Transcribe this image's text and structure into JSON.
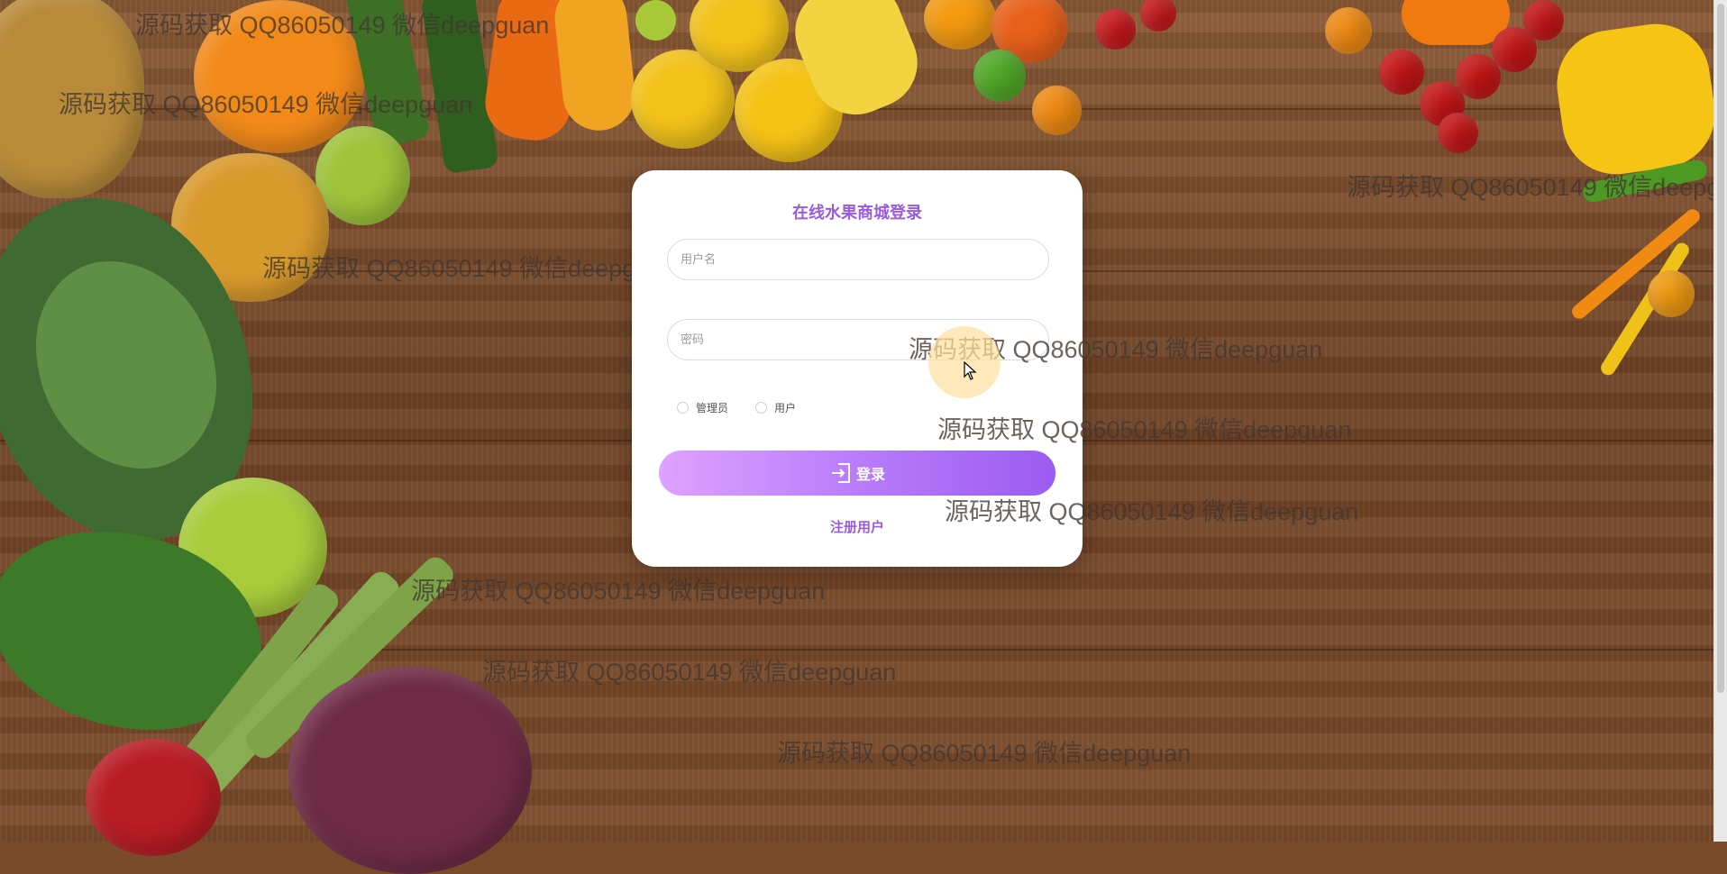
{
  "page": {
    "title": "在线水果商城登录"
  },
  "login": {
    "username_placeholder": "用户名",
    "password_placeholder": "密码",
    "roles": [
      "管理员",
      "用户"
    ],
    "login_label": "登录",
    "register_label": "注册用户"
  },
  "watermark": {
    "text": "源码获取 QQ86050149 微信deepguan"
  },
  "colors": {
    "accent": "#9a5be0",
    "button_start": "#dea2ff",
    "button_end": "#9b5cf0"
  },
  "icons": {
    "login_icon": "login-icon",
    "cursor": "mouse-pointer-icon"
  }
}
